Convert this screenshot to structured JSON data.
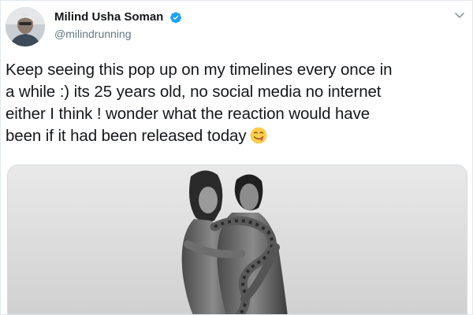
{
  "author": {
    "display_name": "Milind Usha Soman",
    "handle": "@milindrunning",
    "verified": true,
    "avatar_icon": "profile-photo"
  },
  "tweet": {
    "line1": "Keep seeing this pop up on my timelines every once in",
    "line2": "a while :) its 25 years old, no social media no internet",
    "line3": "either I think ! wonder what the reaction would have",
    "line4": "been if it had been released today",
    "emoji_icon": "face-savoring-food-emoji"
  },
  "menu": {
    "caret_icon": "chevron-down-icon"
  },
  "media": {
    "type": "black-and-white photograph"
  },
  "colors": {
    "text": "#14171a",
    "secondary": "#657786",
    "verified_blue": "#1da1f2",
    "border": "#e1e8ed"
  }
}
